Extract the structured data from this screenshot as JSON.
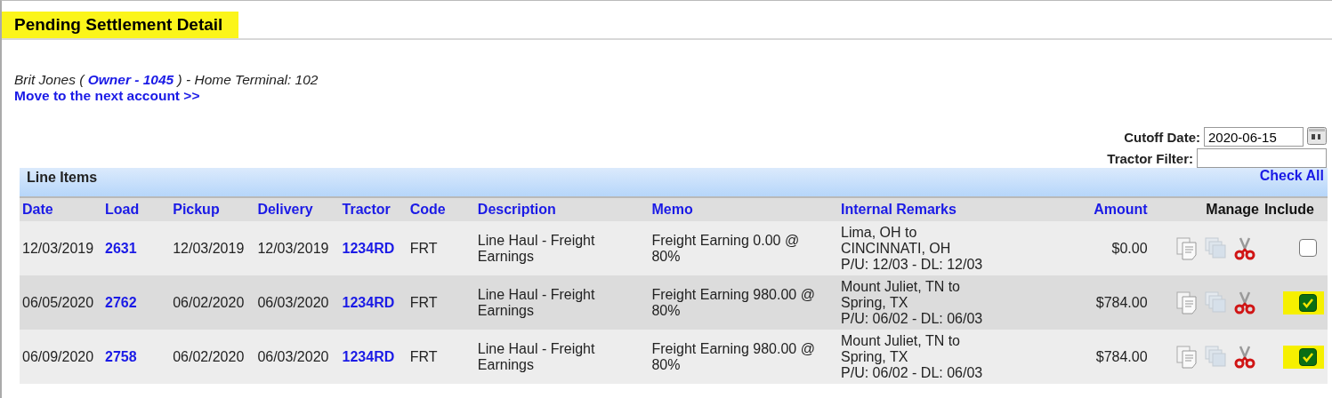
{
  "page": {
    "title": "Pending Settlement Detail"
  },
  "account": {
    "name": "Brit Jones (",
    "owner_link": "Owner - 1045",
    "after": ") - Home Terminal: 102",
    "next_link": "Move to the next account >>"
  },
  "filters": {
    "cutoff_label": "Cutoff Date:",
    "cutoff_value": "2020-06-15",
    "tractor_label": "Tractor Filter:"
  },
  "line_items": {
    "title": "Line Items",
    "check_all": "Check All",
    "columns": [
      "Date",
      "Load",
      "Pickup",
      "Delivery",
      "Tractor",
      "Code",
      "Description",
      "Memo",
      "Internal Remarks",
      "Amount",
      "Manage",
      "Include"
    ],
    "rows": [
      {
        "date": "12/03/2019",
        "load": "2631",
        "pickup": "12/03/2019",
        "delivery": "12/03/2019",
        "tractor": "1234RD",
        "code": "FRT",
        "description": "Line Haul - Freight Earnings",
        "memo": "Freight Earning 0.00 @ 80%",
        "remarks": [
          "Lima, OH to CINCINNATI, OH",
          "P/U: 12/03 - DL: 12/03"
        ],
        "amount": "$0.00",
        "checked": false
      },
      {
        "date": "06/05/2020",
        "load": "2762",
        "pickup": "06/02/2020",
        "delivery": "06/03/2020",
        "tractor": "1234RD",
        "code": "FRT",
        "description": "Line Haul - Freight Earnings",
        "memo": "Freight Earning 980.00 @ 80%",
        "remarks": [
          "Mount Juliet, TN to Spring, TX",
          "P/U: 06/02 - DL: 06/03"
        ],
        "amount": "$784.00",
        "checked": true
      },
      {
        "date": "06/09/2020",
        "load": "2758",
        "pickup": "06/02/2020",
        "delivery": "06/03/2020",
        "tractor": "1234RD",
        "code": "FRT",
        "description": "Line Haul - Freight Earnings",
        "memo": "Freight Earning 980.00 @ 80%",
        "remarks": [
          "Mount Juliet, TN to Spring, TX",
          "P/U: 06/02 - DL: 06/03"
        ],
        "amount": "$784.00",
        "checked": true
      }
    ]
  }
}
